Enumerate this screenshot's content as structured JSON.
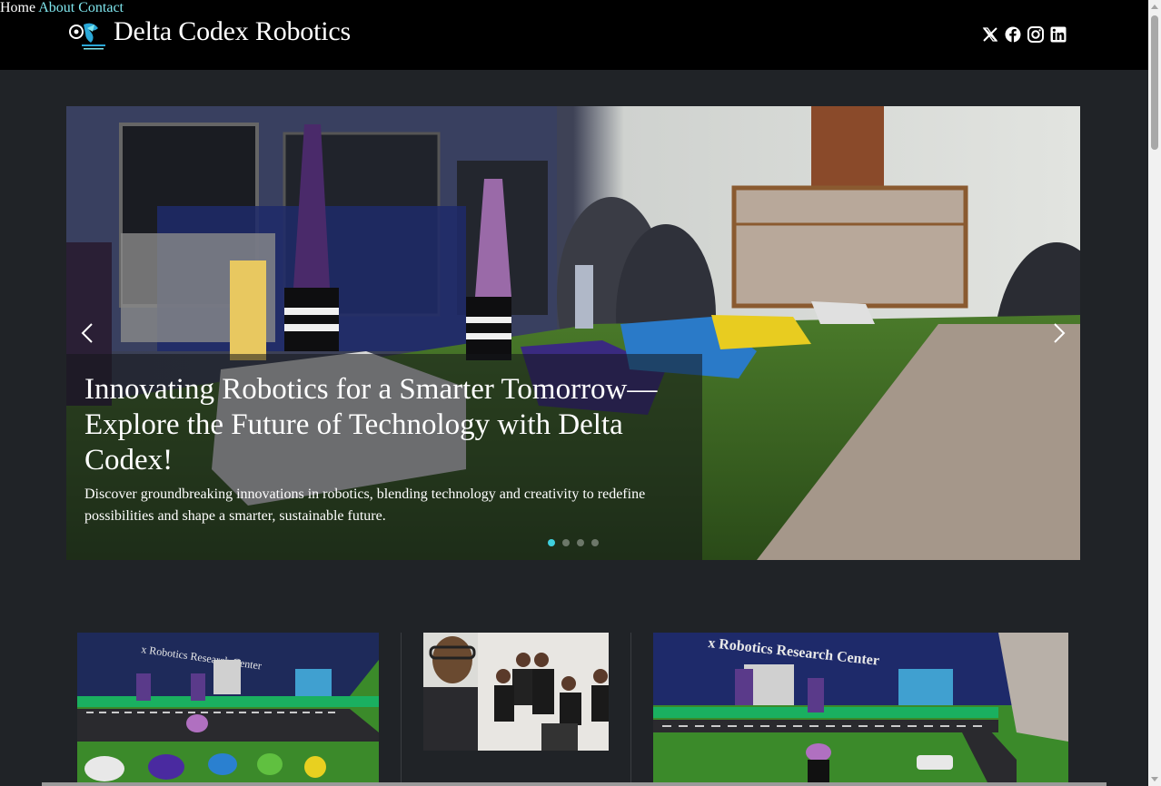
{
  "brand": {
    "name": "Delta Codex Robotics",
    "logo_icon": "robot-logo-icon"
  },
  "nav": {
    "items": [
      {
        "label": "Home",
        "color": "#ffffff"
      },
      {
        "label": "About",
        "color": "#7fe6ee"
      },
      {
        "label": "Contact",
        "color": "#7fe6ee"
      }
    ]
  },
  "social": [
    "x-icon",
    "facebook-icon",
    "instagram-icon",
    "linkedin-icon"
  ],
  "hero": {
    "title": "Innovating Robotics for a Smarter Tomorrow—Explore the Future of Technology with Delta Codex!",
    "text": "Discover groundbreaking innovations in robotics, blending technology and creativity to redefine possibilities and shape a smarter, sustainable future.",
    "slides_total": 4,
    "active_slide": 1,
    "accent": "#3fd0de"
  },
  "cards": {
    "card1": {
      "image_text": "x Robotics Research Center"
    },
    "card3": {
      "image_text": "x Robotics Research Center"
    }
  }
}
